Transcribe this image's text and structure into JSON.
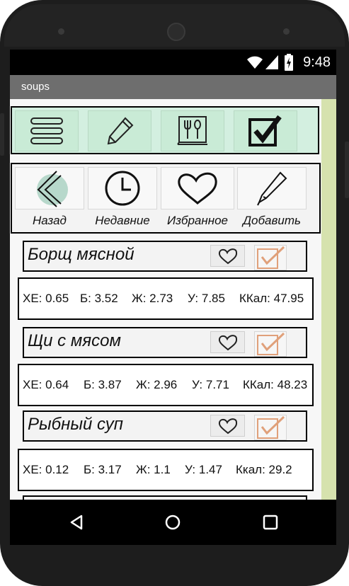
{
  "status": {
    "time": "9:48"
  },
  "app": {
    "title": "soups"
  },
  "toolbar": {
    "icons": [
      "menu-icon",
      "pencil-icon",
      "recipe-book-icon",
      "checkbox-icon"
    ]
  },
  "nav": {
    "back_label": "Назад",
    "recent_label": "Недавние",
    "favorites_label": "Избранное",
    "add_label": "Добавить"
  },
  "soups": [
    {
      "name": "Борщ мясной",
      "xe": "ХЕ: 0.65",
      "b": "Б: 3.52",
      "zh": "Ж: 2.73",
      "u": "У: 7.85",
      "kcal": "ККал: 47.95"
    },
    {
      "name": "Щи с мясом",
      "xe": "ХЕ: 0.64",
      "b": "Б: 3.87",
      "zh": "Ж: 2.96",
      "u": "У: 7.71",
      "kcal": "ККал: 48.23"
    },
    {
      "name": "Рыбный суп",
      "xe": "ХЕ: 0.12",
      "b": "Б: 3.17",
      "zh": "Ж: 1.1",
      "u": "У: 1.47",
      "kcal": "Ккал: 29.2"
    }
  ],
  "colors": {
    "toolbar_bg": "#d3efe0",
    "side_strip": "#d6e2ae",
    "check_accent": "#e0a07a",
    "title_bar": "#6e6e6e"
  }
}
